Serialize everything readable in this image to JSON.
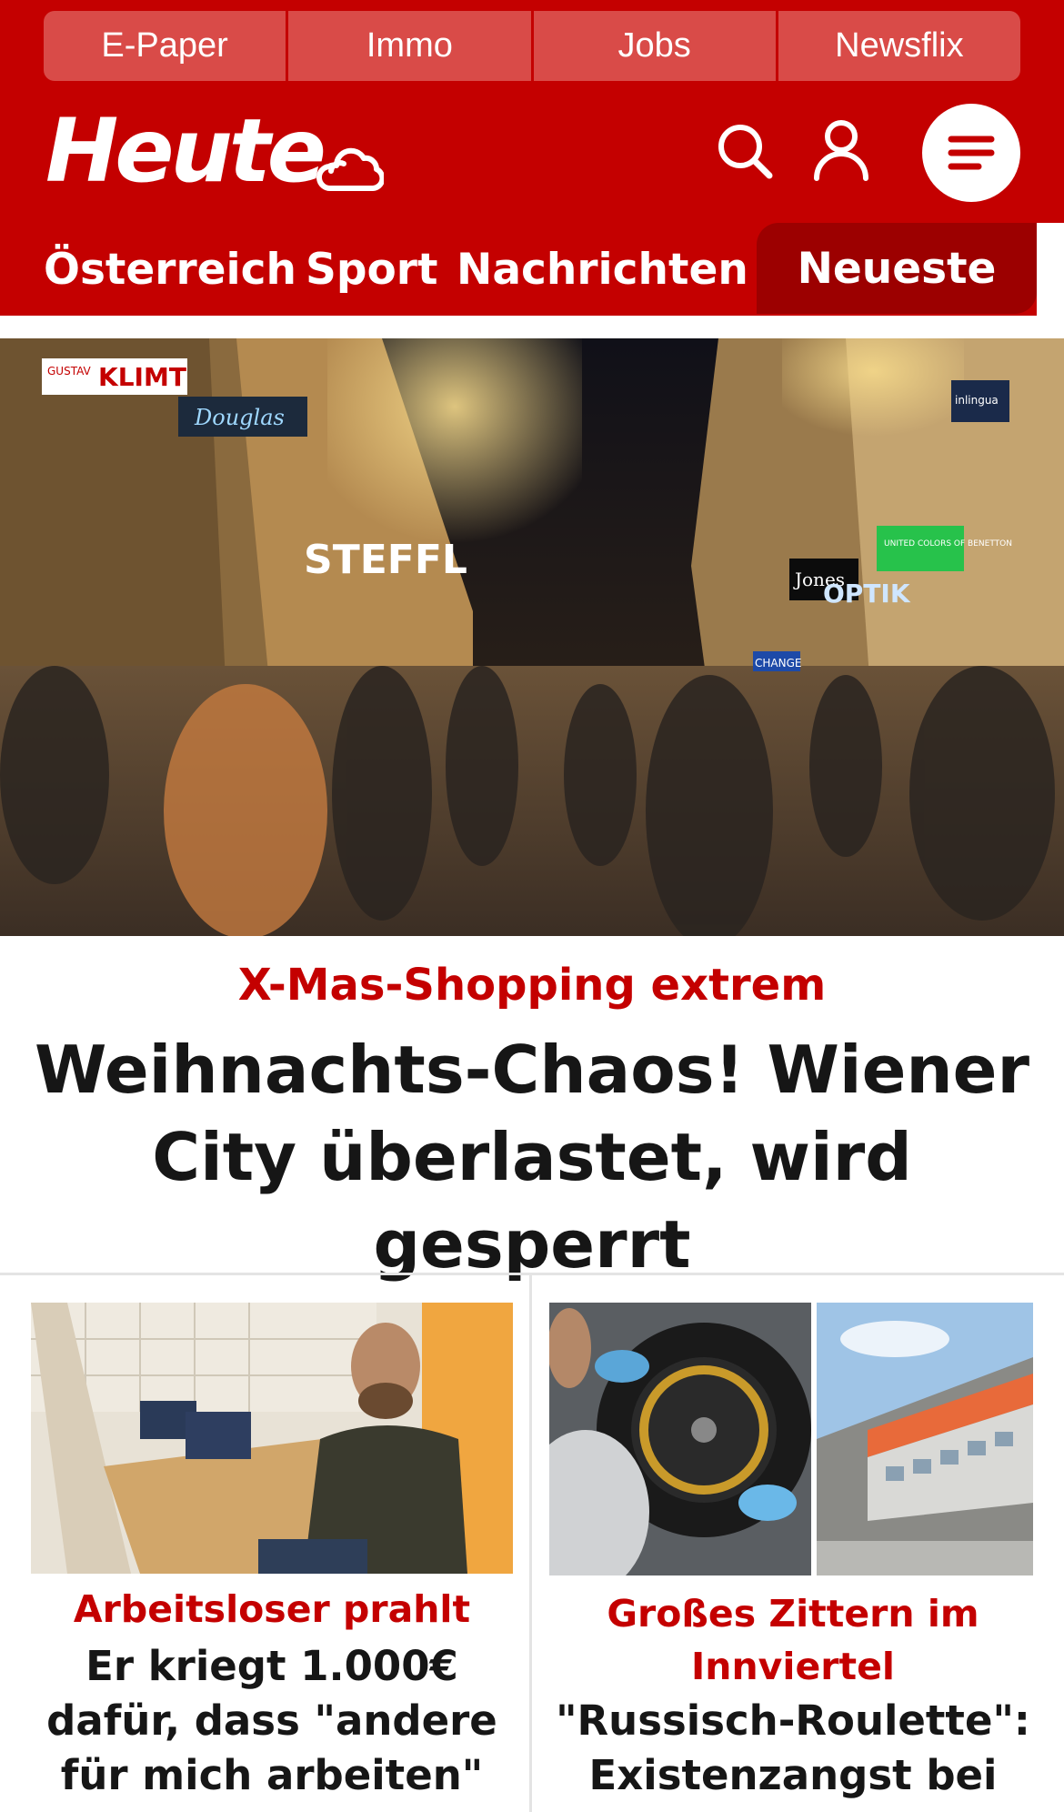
{
  "topbar": {
    "items": [
      {
        "label": "E-Paper"
      },
      {
        "label": "Immo"
      },
      {
        "label": "Jobs"
      },
      {
        "label": "Newsflix"
      }
    ]
  },
  "header": {
    "logo": "Heute",
    "icons": [
      "cloud-weather-icon",
      "search-icon",
      "user-icon",
      "menu-icon"
    ]
  },
  "nav": {
    "items": [
      {
        "label": "Österreich"
      },
      {
        "label": "Sport"
      },
      {
        "label": "Nachrichten"
      }
    ],
    "active_label": "Neueste"
  },
  "hero": {
    "kicker": "X-Mas-Shopping extrem",
    "title": "Weihnachts-Chaos! Wiener City überlastet, wird gesperrt",
    "image_signs": {
      "klimt": "KLIMT",
      "gustav": "GUSTAV",
      "douglas": "Douglas",
      "steffl": "STEFFL",
      "jones": "Jones",
      "optik": "OPTIK",
      "benetton": "UNITED COLORS OF BENETTON",
      "inlingua": "inlingua",
      "change": "CHANGE"
    }
  },
  "teasers": [
    {
      "kicker": "Arbeitsloser prahlt",
      "title": "Er kriegt 1.000€ dafür, dass \"andere für mich arbeiten\""
    },
    {
      "kicker": "Großes Zittern im Innviertel",
      "title": "\"Russisch-Roulette\": Existenzangst bei KTM-"
    }
  ],
  "colors": {
    "brand_red": "#c40000",
    "topbar_tab": "#d94b48",
    "active_tab": "#9c0000",
    "headline": "#161616"
  }
}
